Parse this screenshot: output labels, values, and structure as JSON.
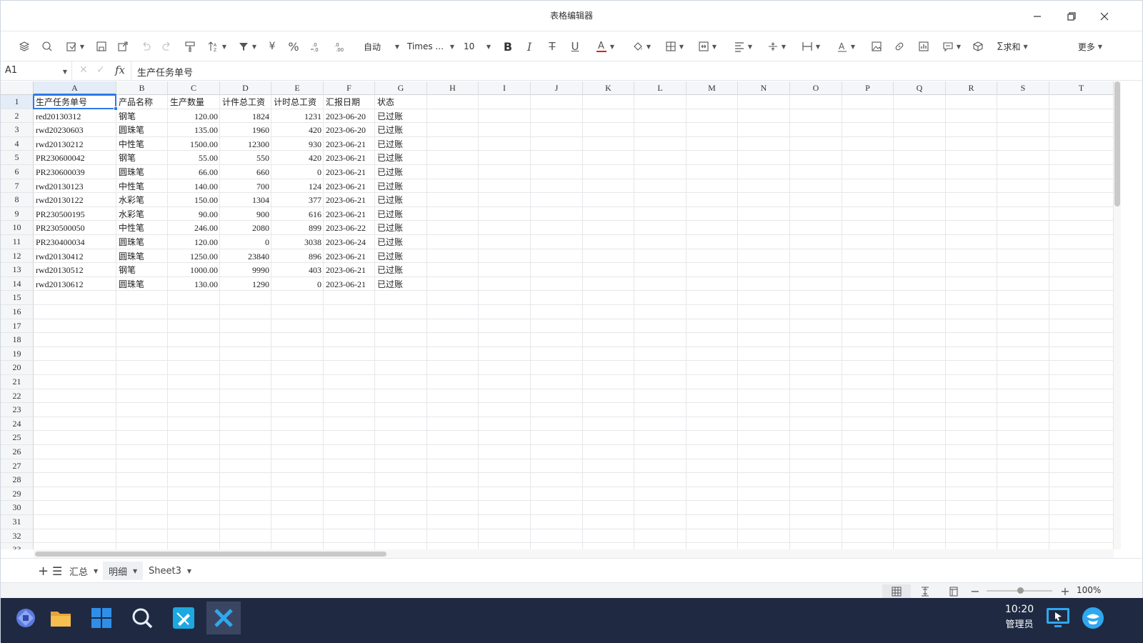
{
  "window": {
    "title": "表格编辑器"
  },
  "toolbar": {
    "auto_label": "自动",
    "font_name": "Times ...",
    "font_size": "10",
    "sum_label": "求和",
    "more_label": "更多",
    "currency": "¥",
    "percent": "%"
  },
  "formula_bar": {
    "cell_ref": "A1",
    "fx": "fx",
    "value": "生产任务单号"
  },
  "columns": [
    "A",
    "B",
    "C",
    "D",
    "E",
    "F",
    "G",
    "H",
    "I",
    "J",
    "K",
    "L",
    "M",
    "N",
    "O",
    "P",
    "Q",
    "R",
    "S",
    "T"
  ],
  "row_numbers": [
    "1",
    "2",
    "3",
    "4",
    "5",
    "6",
    "7",
    "8",
    "9",
    "10",
    "11",
    "12",
    "13",
    "14",
    "15",
    "16",
    "17",
    "18",
    "19",
    "20",
    "21",
    "22",
    "23",
    "24",
    "25",
    "26",
    "27",
    "28",
    "29",
    "30",
    "31",
    "32",
    "33"
  ],
  "table": {
    "headers": [
      "生产任务单号",
      "产品名称",
      "生产数量",
      "计件总工资",
      "计时总工资",
      "汇报日期",
      "状态"
    ],
    "rows": [
      [
        "red20130312",
        "钢笔",
        "120.00",
        "1824",
        "1231",
        "2023-06-20",
        "已过账"
      ],
      [
        "rwd20230603",
        "圆珠笔",
        "135.00",
        "1960",
        "420",
        "2023-06-20",
        "已过账"
      ],
      [
        "rwd20130212",
        "中性笔",
        "1500.00",
        "12300",
        "930",
        "2023-06-21",
        "已过账"
      ],
      [
        "PR230600042",
        "钢笔",
        "55.00",
        "550",
        "420",
        "2023-06-21",
        "已过账"
      ],
      [
        "PR230600039",
        "圆珠笔",
        "66.00",
        "660",
        "0",
        "2023-06-21",
        "已过账"
      ],
      [
        "rwd20130123",
        "中性笔",
        "140.00",
        "700",
        "124",
        "2023-06-21",
        "已过账"
      ],
      [
        "rwd20130122",
        "水彩笔",
        "150.00",
        "1304",
        "377",
        "2023-06-21",
        "已过账"
      ],
      [
        "PR230500195",
        "水彩笔",
        "90.00",
        "900",
        "616",
        "2023-06-21",
        "已过账"
      ],
      [
        "PR230500050",
        "中性笔",
        "246.00",
        "2080",
        "899",
        "2023-06-22",
        "已过账"
      ],
      [
        "PR230400034",
        "圆珠笔",
        "120.00",
        "0",
        "3038",
        "2023-06-24",
        "已过账"
      ],
      [
        "rwd20130412",
        "圆珠笔",
        "1250.00",
        "23840",
        "896",
        "2023-06-21",
        "已过账"
      ],
      [
        "rwd20130512",
        "钢笔",
        "1000.00",
        "9990",
        "403",
        "2023-06-21",
        "已过账"
      ],
      [
        "rwd20130612",
        "圆珠笔",
        "130.00",
        "1290",
        "0",
        "2023-06-21",
        "已过账"
      ]
    ]
  },
  "sheets": [
    {
      "name": "汇总",
      "active": false
    },
    {
      "name": "明细",
      "active": true
    },
    {
      "name": "Sheet3",
      "active": false
    }
  ],
  "status": {
    "zoom": "100%"
  },
  "taskbar": {
    "time": "10:20",
    "user": "管理员"
  },
  "colors": {
    "accent": "#2f7ae5",
    "taskbar": "#1f2a42",
    "font_color_bar": "#e02020"
  }
}
